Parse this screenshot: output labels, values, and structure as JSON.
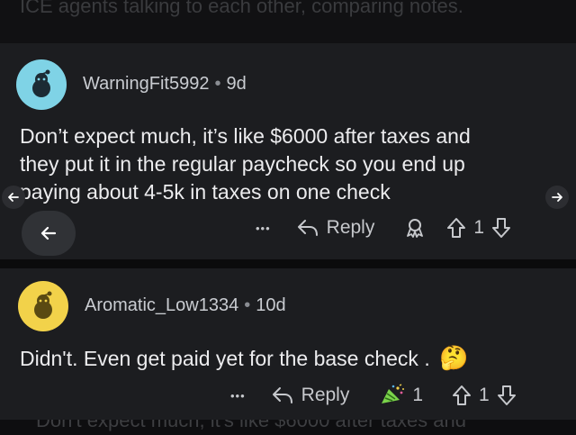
{
  "background_text": {
    "top": "ICE agents talking to each other, comparing notes.",
    "bottom": "Don't expect much, it's like $6000 after taxes and"
  },
  "comment1": {
    "username": "WarningFit5992",
    "separator": "•",
    "age": "9d",
    "lines": [
      "Don’t expect much, it’s like $6000 after taxes and",
      "they put it in the regular paycheck so you end up",
      "paying about 4-5k in taxes on one check"
    ],
    "more": "•••",
    "reply_label": "Reply",
    "vote_count": "1",
    "avatar_color": "#7fd3e6"
  },
  "comment2": {
    "username": "Aromatic_Low1334",
    "separator": "•",
    "age": "10d",
    "text": "Didn't. Even get paid yet for the base check .",
    "emoji": "🤔",
    "more": "•••",
    "reply_label": "Reply",
    "award_count": "1",
    "vote_count": "1",
    "avatar_color": "#f2d24a"
  },
  "colors": {
    "card": "#1c1d20",
    "text": "#ececee",
    "muted": "#c6c8cc"
  }
}
